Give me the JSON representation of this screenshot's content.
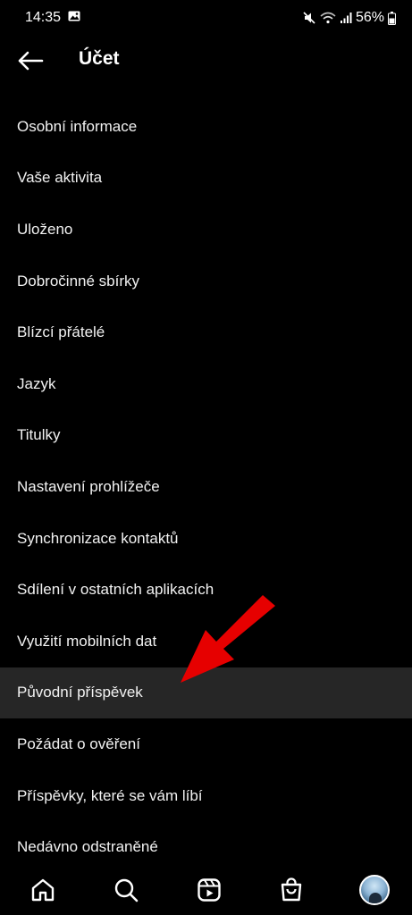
{
  "status_bar": {
    "time": "14:35",
    "battery": "56%",
    "icons": [
      "gallery-notification-icon",
      "mute-icon",
      "wifi-icon",
      "signal-icon",
      "battery-icon"
    ]
  },
  "header": {
    "title": "Účet",
    "back_icon": "arrow-left-icon"
  },
  "menu": {
    "items": [
      {
        "label": "Osobní informace"
      },
      {
        "label": "Vaše aktivita"
      },
      {
        "label": "Uloženo"
      },
      {
        "label": "Dobročinné sbírky"
      },
      {
        "label": "Blízcí přátelé"
      },
      {
        "label": "Jazyk"
      },
      {
        "label": "Titulky"
      },
      {
        "label": "Nastavení prohlížeče"
      },
      {
        "label": "Synchronizace kontaktů"
      },
      {
        "label": "Sdílení v ostatních aplikacích"
      },
      {
        "label": "Využití mobilních dat"
      },
      {
        "label": "Původní příspěvek"
      },
      {
        "label": "Požádat o ověření"
      },
      {
        "label": "Příspěvky, které se vám líbí"
      },
      {
        "label": "Nedávno odstraněné"
      }
    ],
    "highlighted_index": 11,
    "highlight_color": "#262626"
  },
  "annotation": {
    "arrow_color": "#e60000"
  },
  "bottom_nav": {
    "items": [
      "home-icon",
      "search-icon",
      "reels-icon",
      "shop-icon",
      "profile-avatar"
    ]
  }
}
